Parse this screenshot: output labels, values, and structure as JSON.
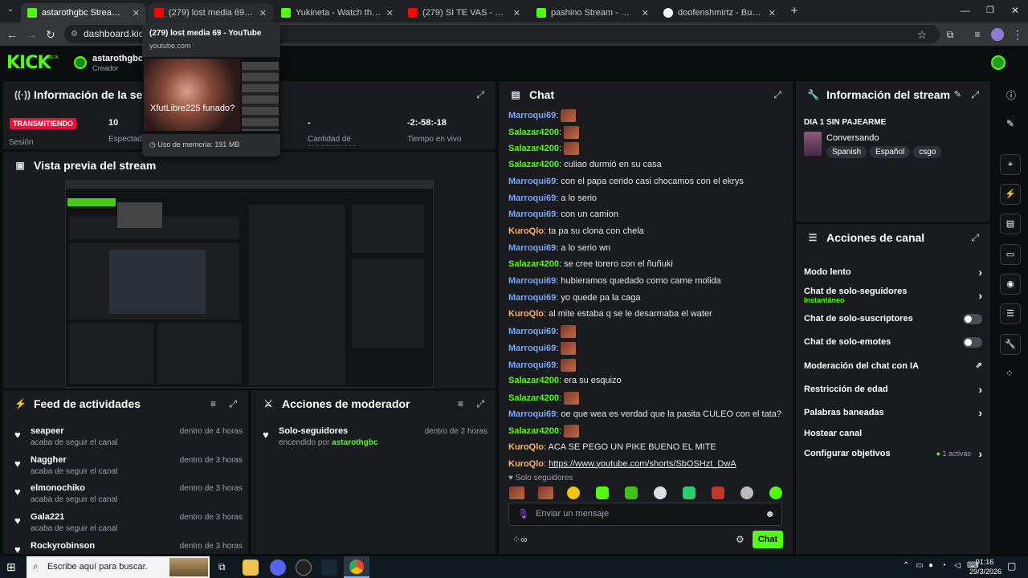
{
  "browser": {
    "tabs": [
      {
        "label": "astarothgbc Stream - Kick Dash"
      },
      {
        "label": "(279) lost media 69 - YouTube"
      },
      {
        "label": "Yukineta - Watch the VOD on K"
      },
      {
        "label": "(279) SI TE VAS - @ITHANNY | Y"
      },
      {
        "label": "pashino Stream - Watch Live on"
      },
      {
        "label": "doofenshmirtz - Buscar con Go"
      }
    ],
    "url": "dashboard.kick.co",
    "tooltip": {
      "title": "(279) lost media 69 - YouTube",
      "domain": "youtube.com",
      "overlay_text": "XfutLibre225 funado?",
      "memory": "Uso de memoria: 191 MB"
    }
  },
  "header": {
    "logo": "KICK",
    "logo_beta": "BETA",
    "username": "astarothgbc",
    "role": "Creador"
  },
  "session": {
    "title": "Información de la sesión",
    "status": "TRANSMITIENDO",
    "status_label": "Sesión",
    "viewers": "10",
    "viewers_label": "Espectadores",
    "subs": "-",
    "subs_label": "Cantidad de suscripciones",
    "live_time": "-2:-58:-18",
    "live_label": "Tiempo en vivo"
  },
  "preview": {
    "title": "Vista previa del stream"
  },
  "activity": {
    "title": "Feed de actividades",
    "items": [
      {
        "name": "seapeer",
        "desc": "acaba de seguir el canal",
        "time": "dentro de 4 horas"
      },
      {
        "name": "Naggher",
        "desc": "acaba de seguir el canal",
        "time": "dentro de 3 horas"
      },
      {
        "name": "elmonochiko",
        "desc": "acaba de seguir el canal",
        "time": "dentro de 3 horas"
      },
      {
        "name": "Gala221",
        "desc": "acaba de seguir el canal",
        "time": "dentro de 3 horas"
      },
      {
        "name": "Rockyrobinson",
        "desc": "",
        "time": "dentro de 3 horas"
      }
    ]
  },
  "moderator": {
    "title": "Acciones de moderador",
    "items": [
      {
        "name": "Solo-seguidores",
        "desc_prefix": "encendido por",
        "by": "astarothgbc",
        "time": "dentro de 2 horas"
      }
    ]
  },
  "chat": {
    "title": "Chat",
    "messages": [
      {
        "user": "Marroqui69",
        "text": "",
        "emote": true
      },
      {
        "user": "Salazar4200",
        "text": "",
        "emote": true
      },
      {
        "user": "Salazar4200",
        "text": "",
        "emote": true
      },
      {
        "user": "Salazar4200",
        "text": ": culiao durmió en su casa",
        "emote": false
      },
      {
        "user": "Marroqui69",
        "text": ": con el papa cerido casi chocamos con el ekrys",
        "emote": false
      },
      {
        "user": "Marroqui69",
        "text": ": a lo serio",
        "emote": false
      },
      {
        "user": "Marroqui69",
        "text": ": con un camion",
        "emote": false
      },
      {
        "user": "KuroQlo",
        "text": ": ta pa su clona con chela",
        "emote": false
      },
      {
        "user": "Marroqui69",
        "text": ": a lo serio wn",
        "emote": false
      },
      {
        "user": "Salazar4200",
        "text": ": se cree torero con el ñuñuki",
        "emote": false
      },
      {
        "user": "Marroqui69",
        "text": ": hubieramos quedado como carne molida",
        "emote": false
      },
      {
        "user": "Marroqui69",
        "text": ": yo quede pa la caga",
        "emote": false
      },
      {
        "user": "KuroQlo",
        "text": ": al mite estaba q se le desarmaba el water",
        "emote": false
      },
      {
        "user": "Marroqui69",
        "text": "",
        "emote": true
      },
      {
        "user": "Marroqui69",
        "text": "",
        "emote": true
      },
      {
        "user": "Marroqui69",
        "text": "",
        "emote": true
      },
      {
        "user": "Salazar4200",
        "text": ": era su esquizo",
        "emote": false
      },
      {
        "user": "Salazar4200",
        "text": "",
        "emote": true
      },
      {
        "user": "Marroqui69",
        "text": ": oe que wea es verdad que la pasita CULEO con el tata?",
        "emote": false
      },
      {
        "user": "Salazar4200",
        "text": "",
        "emote": true
      },
      {
        "user": "KuroQlo",
        "text": ": ACA SE PEGO UN PIKE BUENO EL MITE",
        "emote": false
      },
      {
        "user": "KuroQlo",
        "text": ": ",
        "link": "https://www.youtube.com/shorts/SbOSHzt_DwA",
        "emote": false
      }
    ],
    "followers_only": "Solo seguidores",
    "input_placeholder": "Enviar un mensaje",
    "send_label": "Chat"
  },
  "stream_info": {
    "title": "Información del stream",
    "stream_title": "DIA 1 SIN PAJEARME",
    "category": "Conversando",
    "tags": [
      "Spanish",
      "Español",
      "csgo"
    ]
  },
  "channel_actions": {
    "title": "Acciones de canal",
    "slow_mode": "Modo lento",
    "followers_only": "Chat de solo-seguidores",
    "followers_only_sub": "Instantáneo",
    "subs_only": "Chat de solo-suscriptores",
    "emotes_only": "Chat de solo-emotes",
    "ai_mod": "Moderación del chat con IA",
    "age": "Restricción de edad",
    "banned_words": "Palabras baneadas",
    "host": "Hostear canal",
    "goals": "Configurar objetivos",
    "goals_active": "1 activas"
  },
  "taskbar": {
    "search": "Escribe aquí para buscar.",
    "time": "01:16",
    "date": "29/3/2026"
  },
  "colors": {
    "accent": "#53fc18",
    "live": "#e9113c",
    "username_blue": "#7ea6f7",
    "username_green": "#53fc18",
    "username_orange": "#ffb36b"
  }
}
